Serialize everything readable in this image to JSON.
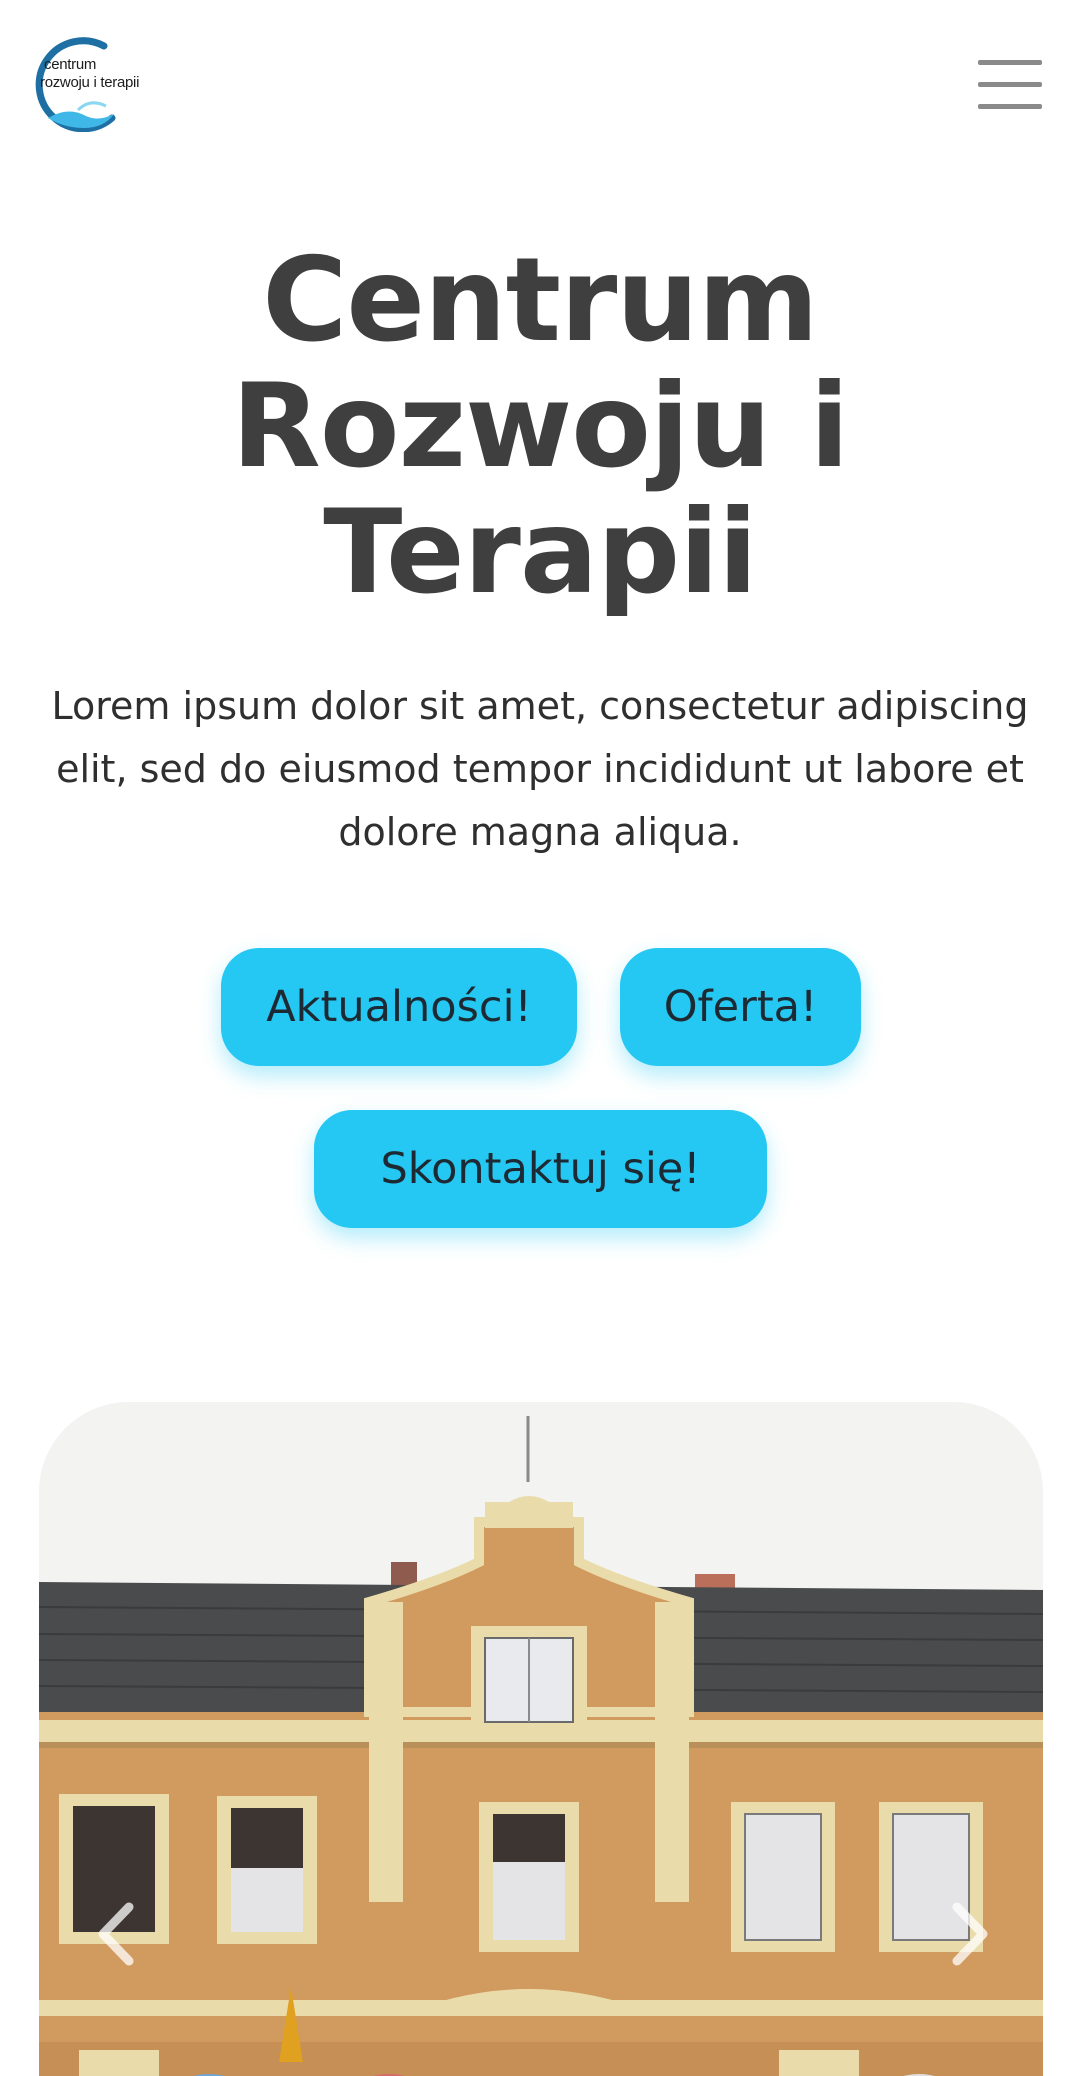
{
  "header": {
    "logo": {
      "line1": "centrum",
      "line2": "rozwoju i terapii",
      "ring_color": "#1e6fa3",
      "wave_color": "#3fb8e8"
    },
    "menu_icon": "hamburger-menu-icon"
  },
  "hero": {
    "title_line1": "Centrum",
    "title_line2": "Rozwoju i",
    "title_line3": "Terapii",
    "text": "Lorem ipsum dolor sit amet, consectetur adipiscing elit, sed do eiusmod tempor incididunt ut labore et dolore magna aliqua."
  },
  "buttons": {
    "news": "Aktualności!",
    "offer": "Oferta!",
    "contact": "Skontaktuj się!"
  },
  "slider": {
    "image_subject": "building-facade",
    "prev_icon": "chevron-left-icon",
    "next_icon": "chevron-right-icon"
  },
  "colors": {
    "accent": "#25c8f2",
    "title": "#3f3f3f",
    "text": "#2f2f2f",
    "facade": "#d19a5f",
    "trim": "#eadcaa",
    "roof": "#4a4b4d"
  }
}
